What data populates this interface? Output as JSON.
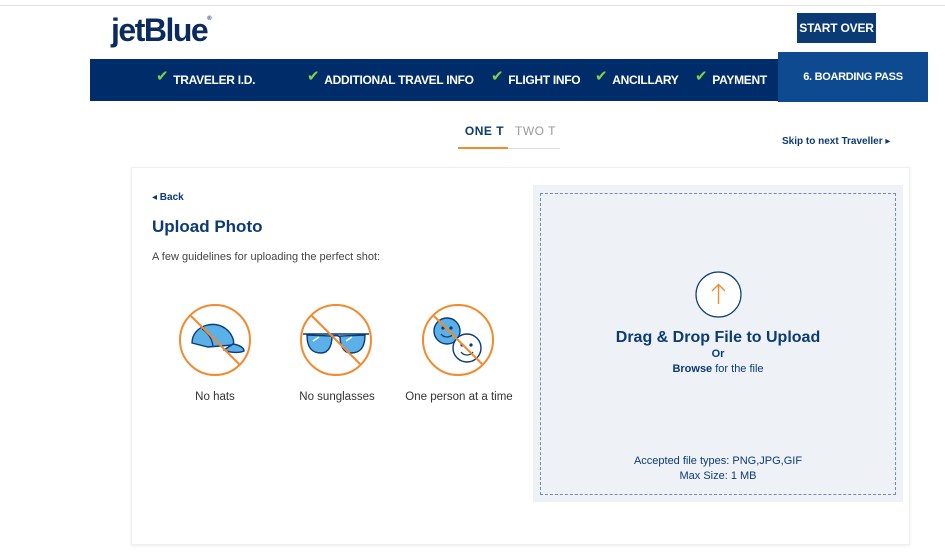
{
  "brand": {
    "logo_text": "jetBlue",
    "logo_mark": "®"
  },
  "header": {
    "start_over_label": "START OVER"
  },
  "steps": [
    {
      "label": "TRAVELER I.D.",
      "done": true
    },
    {
      "label": "ADDITIONAL TRAVEL INFO",
      "done": true
    },
    {
      "label": "FLIGHT INFO",
      "done": true
    },
    {
      "label": "ANCILLARY",
      "done": true
    },
    {
      "label": "PAYMENT",
      "done": true
    },
    {
      "label": "6. BOARDING PASS",
      "done": false,
      "active": true
    }
  ],
  "check_glyph": "✔",
  "passenger_tabs": {
    "active": "ONE T",
    "inactive": "TWO T"
  },
  "skip_link": "Skip to next Traveller ▸",
  "upload": {
    "back_label": "◂ Back",
    "title": "Upload Photo",
    "subtitle": "A few guidelines for uploading the perfect shot:",
    "guidelines": [
      {
        "label": "No hats",
        "icon": "no-hat-icon"
      },
      {
        "label": "No sunglasses",
        "icon": "no-sunglasses-icon"
      },
      {
        "label": "One person at a time",
        "icon": "one-person-icon"
      }
    ]
  },
  "dropzone": {
    "title": "Drag & Drop File to Upload",
    "or": "Or",
    "browse": "Browse",
    "browse_suffix": " for the file",
    "accepted": "Accepted file types: PNG,JPG,GIF",
    "max_size": "Max Size: 1 MB"
  },
  "colors": {
    "navy": "#002d6a",
    "accent_orange": "#f28a2e",
    "check_green": "#7fd04a",
    "link_blue": "#0b3a75"
  }
}
